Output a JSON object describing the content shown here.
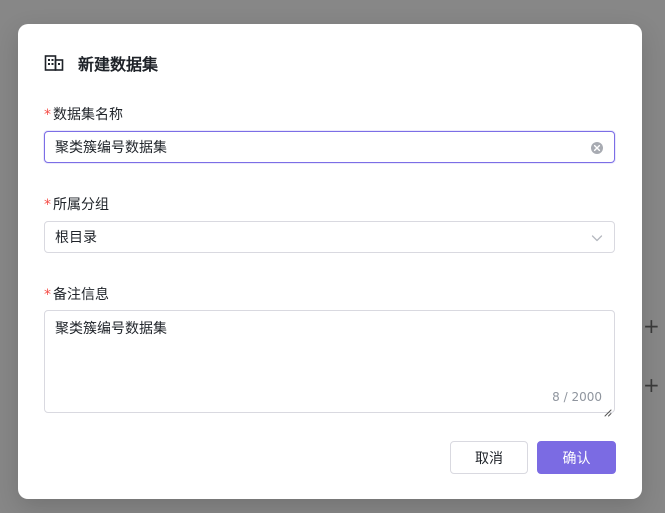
{
  "dialog": {
    "title": "新建数据集",
    "header_icon": "dataset-icon"
  },
  "fields": {
    "name": {
      "required_mark": "*",
      "label": "数据集名称",
      "value": "聚类簇编号数据集",
      "clear_icon": "clear-circle-icon"
    },
    "group": {
      "required_mark": "*",
      "label": "所属分组",
      "value": "根目录",
      "dropdown_icon": "chevron-down-icon"
    },
    "remark": {
      "required_mark": "*",
      "label": "备注信息",
      "value": "聚类簇编号数据集",
      "char_count": "8 / 2000"
    }
  },
  "buttons": {
    "cancel": "取消",
    "confirm": "确认"
  },
  "backdrop": {
    "plus_symbol": "+"
  },
  "colors": {
    "primary": "#7b6be3",
    "required": "#f54a45",
    "backdrop": "#878787"
  }
}
